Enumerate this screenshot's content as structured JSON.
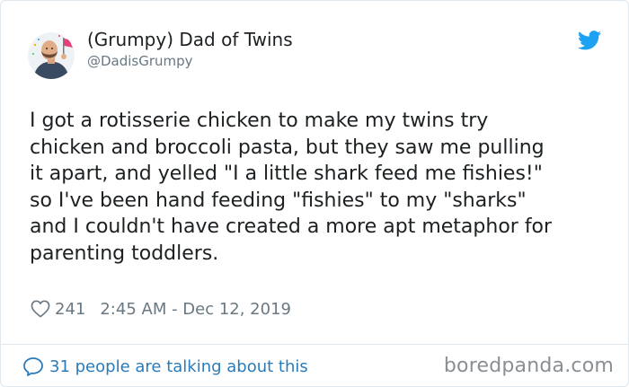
{
  "author": {
    "display_name": "(Grumpy) Dad of Twins",
    "handle": "@DadisGrumpy",
    "avatar_icon": "person-with-flag-avatar"
  },
  "tweet": {
    "text": "I got a rotisserie chicken to make my twins try\nchicken and broccoli pasta, but they saw me pulling\nit apart, and yelled \"I a little shark feed me fishies!\"\nso I've been hand feeding \"fishies\" to my \"sharks\"\nand I couldn't have created a more apt metaphor for\nparenting toddlers.",
    "likes": "241",
    "timestamp": "2:45 AM - Dec 12, 2019"
  },
  "footer": {
    "conversation_label": "31 people are talking about this",
    "watermark": "boredpanda.com"
  },
  "colors": {
    "text": "#1c2022",
    "muted": "#697882",
    "link": "#2b7bb9",
    "twitter_blue": "#1da1f2",
    "border": "#e1e8ed"
  },
  "icons": {
    "brand": "twitter-bird-icon",
    "like": "heart-icon",
    "reply": "speech-bubble-icon"
  }
}
